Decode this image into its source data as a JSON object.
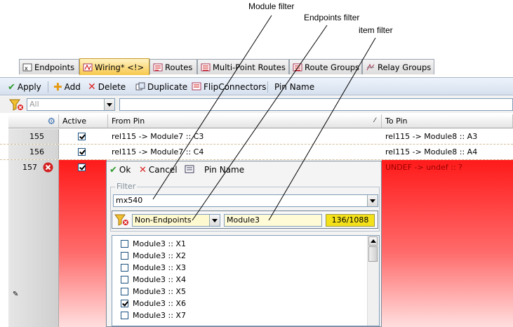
{
  "annotations": {
    "module_filter": "Module filter",
    "endpoints_filter": "Endpoints filter",
    "item_filter": "item filter"
  },
  "tabs": [
    {
      "label": "Endpoints",
      "icon": "endpoints-icon"
    },
    {
      "label": "Wiring* <!>",
      "icon": "wiring-icon",
      "active": true
    },
    {
      "label": "Routes",
      "icon": "routes-icon"
    },
    {
      "label": "Multi-Point Routes",
      "icon": "multipoint-routes-icon"
    },
    {
      "label": "Route Groups",
      "icon": "route-groups-icon"
    },
    {
      "label": "Relay Groups",
      "icon": "relay-groups-icon"
    }
  ],
  "toolbar": {
    "apply": "Apply",
    "add": "Add",
    "delete": "Delete",
    "duplicate": "Duplicate",
    "flip": "FlipConnectors",
    "pin_name": "Pin Name"
  },
  "filter_row": {
    "combo_value": "All"
  },
  "grid": {
    "headers": {
      "active": "Active",
      "from_pin": "From Pin",
      "to_pin": "To Pin"
    },
    "rows": [
      {
        "num": "155",
        "active": true,
        "from": "rel115 -> Module7 :: C3",
        "to": "rel115 -> Module8 :: A3"
      },
      {
        "num": "156",
        "active": true,
        "from": "rel115 -> Module7 :: C4",
        "to": "rel115 -> Module8 :: A4"
      },
      {
        "num": "157",
        "active": true,
        "from": "",
        "to": "UNDEF -> undef :: ?",
        "error": true
      }
    ]
  },
  "popup": {
    "ok": "Ok",
    "cancel": "Cancel",
    "pin_name": "Pin Name",
    "filter_label": "Filter",
    "module_value": "mx540",
    "endpoints_value": "Non-Endpoints",
    "item_value": "Module3",
    "count": "136/1088",
    "items": [
      {
        "label": "Module3 :: X1",
        "checked": false
      },
      {
        "label": "Module3 :: X2",
        "checked": false
      },
      {
        "label": "Module3 :: X3",
        "checked": false
      },
      {
        "label": "Module3 :: X4",
        "checked": false
      },
      {
        "label": "Module3 :: X5",
        "checked": false
      },
      {
        "label": "Module3 :: X6",
        "checked": true
      },
      {
        "label": "Module3 :: X7",
        "checked": false
      }
    ]
  },
  "colors": {
    "error_red": "#ff0000",
    "count_bg": "#f5e11a",
    "tab_active": "#f7c84c"
  }
}
